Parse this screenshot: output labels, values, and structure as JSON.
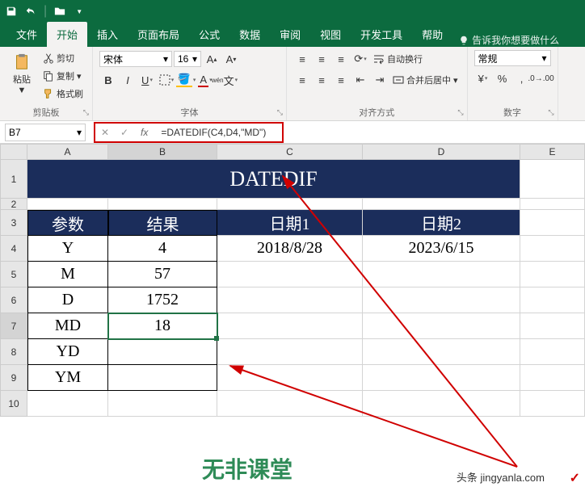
{
  "quickAccess": {
    "save": "save",
    "undo": "undo",
    "folder": "folder"
  },
  "tabs": {
    "file": "文件",
    "home": "开始",
    "insert": "插入",
    "layout": "页面布局",
    "formulas": "公式",
    "data": "数据",
    "review": "审阅",
    "view": "视图",
    "dev": "开发工具",
    "help": "帮助",
    "tellMe": "告诉我你想要做什么"
  },
  "ribbon": {
    "paste": "粘贴",
    "cut": "剪切",
    "copy": "复制",
    "formatPainter": "格式刷",
    "clipboard": "剪贴板",
    "fontName": "宋体",
    "fontSize": "16",
    "fontGroup": "字体",
    "wrap": "自动换行",
    "merge": "合并后居中",
    "alignGroup": "对齐方式",
    "numberFormat": "常规",
    "numberGroup": "数字"
  },
  "nameBox": "B7",
  "formula": "=DATEDIF(C4,D4,\"MD\")",
  "headers": {
    "A": "A",
    "B": "B",
    "C": "C",
    "D": "D",
    "E": "E"
  },
  "sheet": {
    "title": "DATEDIF",
    "col1": "参数",
    "col2": "结果",
    "col3": "日期1",
    "col4": "日期2",
    "date1": "2018/8/28",
    "date2": "2023/6/15",
    "rows": [
      {
        "param": "Y",
        "result": "4"
      },
      {
        "param": "M",
        "result": "57"
      },
      {
        "param": "D",
        "result": "1752"
      },
      {
        "param": "MD",
        "result": "18"
      },
      {
        "param": "YD",
        "result": ""
      },
      {
        "param": "YM",
        "result": ""
      }
    ]
  },
  "watermarks": {
    "w1": "无非课堂",
    "w2": "头条 jingyanla.com",
    "w3": "✓"
  }
}
